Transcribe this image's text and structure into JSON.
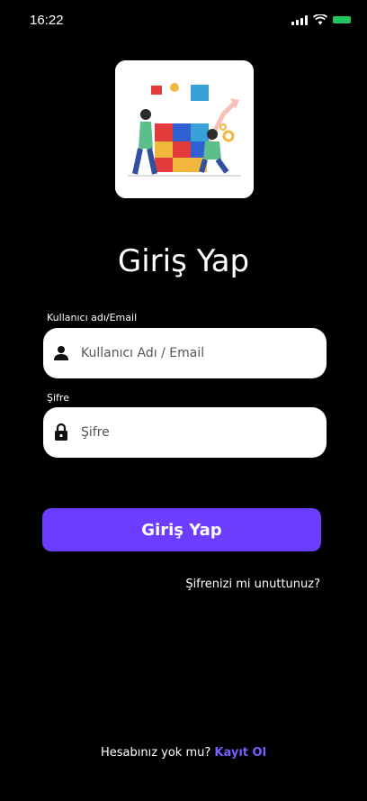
{
  "status_bar": {
    "time": "16:22",
    "battery_color": "#22c55e"
  },
  "logo": {
    "icon": "puzzle-teamwork-illustration"
  },
  "title": "Giriş Yap",
  "username": {
    "label": "Kullanıcı adı/Email",
    "placeholder": "Kullanıcı Adı / Email",
    "icon": "user-icon"
  },
  "password": {
    "label": "Şifre",
    "placeholder": "Şifre",
    "icon": "lock-icon"
  },
  "login_button": {
    "label": "Giriş Yap",
    "color": "#6c3cff"
  },
  "forgot_password": "Şifrenizi mi unuttunuz?",
  "signup": {
    "prompt": "Hesabınız yok mu?",
    "link": "Kayıt Ol",
    "link_color": "#7b5cff"
  }
}
